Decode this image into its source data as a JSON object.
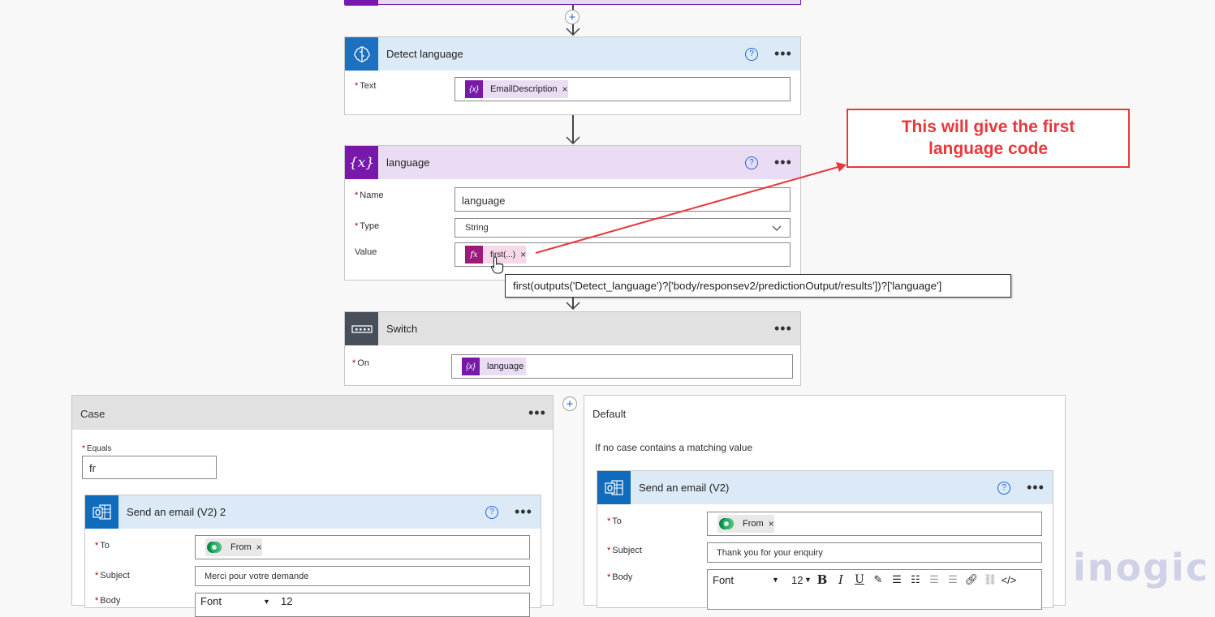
{
  "colors": {
    "accent": "#2266d4",
    "variable": "#7719aa",
    "expression": "#9c1b7a",
    "callout": "#e8383d",
    "outlook": "#0f6cbd"
  },
  "detect": {
    "title": "Detect language",
    "text_label": "Text",
    "token": "EmailDescription"
  },
  "variable": {
    "title": "language",
    "name_label": "Name",
    "name_value": "language",
    "type_label": "Type",
    "type_value": "String",
    "value_label": "Value",
    "value_token": "first(...)"
  },
  "tooltip": "first(outputs('Detect_language')?['body/responsev2/predictionOutput/results'])?['language']",
  "callout": {
    "line1": "This will give the first",
    "line2": "language code"
  },
  "switch": {
    "title": "Switch",
    "on_label": "On",
    "on_token": "language"
  },
  "case": {
    "title": "Case",
    "equals_label": "Equals",
    "equals_value": "fr"
  },
  "email_case": {
    "title": "Send an email (V2) 2",
    "to_label": "To",
    "to_token": "From",
    "subject_label": "Subject",
    "subject_value": "Merci pour votre demande",
    "body_label": "Body",
    "font": "Font",
    "size": "12"
  },
  "default": {
    "title": "Default",
    "subtitle": "If no case contains a matching value"
  },
  "email_default": {
    "title": "Send an email (V2)",
    "to_label": "To",
    "to_token": "From",
    "subject_label": "Subject",
    "subject_value": "Thank you for your enquiry",
    "body_label": "Body",
    "font": "Font",
    "size": "12"
  },
  "watermark": "inogic"
}
